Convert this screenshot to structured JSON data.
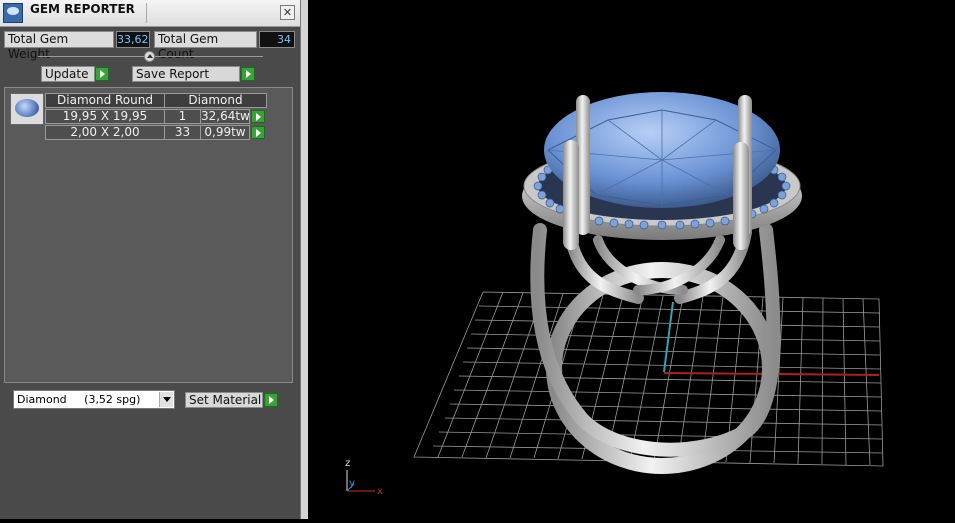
{
  "app": {
    "title": "GEM REPORTER",
    "close_icon": "close-icon",
    "app_icon": "gem-reporter-icon"
  },
  "stats": {
    "total_weight_label": "Total Gem Weight",
    "total_weight_value": "33,62",
    "total_count_label": "Total Gem Count",
    "total_count_value": "34"
  },
  "toolbar": {
    "update_label": "Update",
    "save_report_label": "Save Report"
  },
  "table": {
    "headers": [
      "Diamond Round",
      "Diamond"
    ],
    "rows": [
      {
        "size": "19,95 X 19,95",
        "count": "1",
        "weight": "32,64tw"
      },
      {
        "size": "2,00 X 2,00",
        "count": "33",
        "weight": "0,99tw"
      }
    ]
  },
  "material": {
    "selected": "Diamond     (3,52 spg)",
    "set_label": "Set Material"
  },
  "viewport": {
    "axis_labels": {
      "z": "z",
      "y": "y",
      "x": "x"
    }
  },
  "colors": {
    "panel": "#4a4a4a",
    "value_text": "#7fc1ff",
    "play_green": "#39a339",
    "gem_blue": "#5b86c9",
    "metal": "#d4d4d4"
  }
}
